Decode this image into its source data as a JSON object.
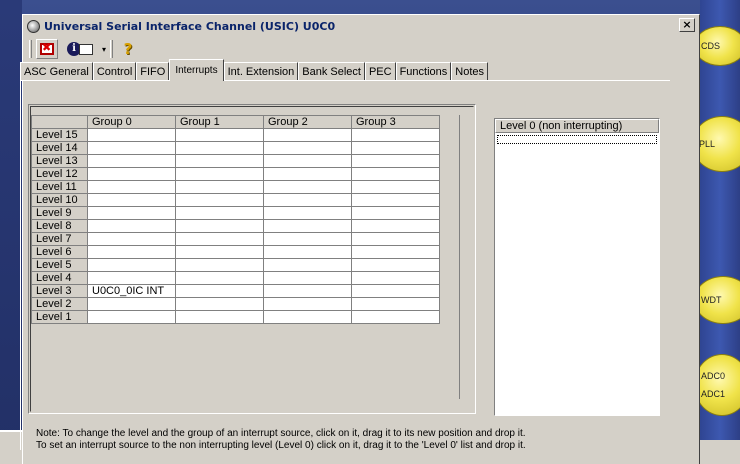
{
  "window": {
    "title": "Universal Serial Interface Channel (USIC) U0C0",
    "close_label": "×"
  },
  "toolbar": {
    "icons": [
      "exit-icon",
      "info-icon",
      "book-icon",
      "chevron-down-icon",
      "help-icon"
    ],
    "dropdown_glyph": "▾",
    "help_glyph": "?"
  },
  "tabs": [
    {
      "label": "ASC General",
      "active": false
    },
    {
      "label": "Control",
      "active": false
    },
    {
      "label": "FIFO",
      "active": false
    },
    {
      "label": "Interrupts",
      "active": true
    },
    {
      "label": "Int. Extension",
      "active": false
    },
    {
      "label": "Bank Select",
      "active": false
    },
    {
      "label": "PEC",
      "active": false
    },
    {
      "label": "Functions",
      "active": false
    },
    {
      "label": "Notes",
      "active": false
    }
  ],
  "grid": {
    "columns": [
      "Group 0",
      "Group 1",
      "Group 2",
      "Group 3"
    ],
    "rows": [
      {
        "label": "Level 15",
        "cells": [
          "",
          "",
          "",
          ""
        ]
      },
      {
        "label": "Level 14",
        "cells": [
          "",
          "",
          "",
          ""
        ]
      },
      {
        "label": "Level 13",
        "cells": [
          "",
          "",
          "",
          ""
        ]
      },
      {
        "label": "Level 12",
        "cells": [
          "",
          "",
          "",
          ""
        ]
      },
      {
        "label": "Level 11",
        "cells": [
          "",
          "",
          "",
          ""
        ]
      },
      {
        "label": "Level 10",
        "cells": [
          "",
          "",
          "",
          ""
        ]
      },
      {
        "label": "Level 9",
        "cells": [
          "",
          "",
          "",
          ""
        ]
      },
      {
        "label": "Level 8",
        "cells": [
          "",
          "",
          "",
          ""
        ]
      },
      {
        "label": "Level 7",
        "cells": [
          "",
          "",
          "",
          ""
        ]
      },
      {
        "label": "Level 6",
        "cells": [
          "",
          "",
          "",
          ""
        ]
      },
      {
        "label": "Level 5",
        "cells": [
          "",
          "",
          "",
          ""
        ]
      },
      {
        "label": "Level 4",
        "cells": [
          "",
          "",
          "",
          ""
        ]
      },
      {
        "label": "Level 3",
        "cells": [
          "U0C0_0IC INT",
          "",
          "",
          ""
        ]
      },
      {
        "label": "Level 2",
        "cells": [
          "",
          "",
          "",
          ""
        ]
      },
      {
        "label": "Level 1",
        "cells": [
          "",
          "",
          "",
          ""
        ]
      }
    ]
  },
  "level0_list": {
    "header": "Level 0 (non interrupting)",
    "items": []
  },
  "note": {
    "line1": "Note: To change the level and the group of an interrupt source, click on it, drag it to its new position and drop it.",
    "line2": "To set an interrupt source to the non interrupting level (Level 0) click on it, drag it to the 'Level 0' list and drop it."
  },
  "background_modules": {
    "cds": "CDS",
    "pll": "PLL",
    "wdt": "WDT",
    "adc0": "ADC0",
    "adc1": "ADC1"
  },
  "colors": {
    "dialog_bg": "#d4d0c8",
    "desktop_blue": "#2c3c78",
    "module_yellow": "#f0e34a",
    "title_text": "#0a246a"
  }
}
